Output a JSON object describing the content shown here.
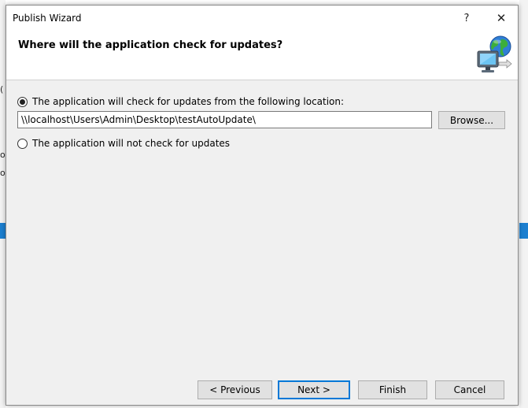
{
  "window": {
    "title": "Publish Wizard",
    "help_glyph": "?",
    "close_glyph": "✕"
  },
  "header": {
    "title": "Where will the application check for updates?",
    "icon": "globe-computer-icon"
  },
  "options": {
    "check_label": "The application will check for updates from the following location:",
    "check_selected": true,
    "no_check_label": "The application will not check for updates",
    "no_check_selected": false
  },
  "location": {
    "value": "\\\\localhost\\Users\\Admin\\Desktop\\testAutoUpdate\\",
    "browse_label": "Browse..."
  },
  "footer": {
    "previous_label": "< Previous",
    "next_label": "Next >",
    "finish_label": "Finish",
    "cancel_label": "Cancel"
  },
  "background": {
    "fragment_1": "(",
    "fragment_2": "ol",
    "fragment_3": "ol"
  },
  "colors": {
    "accent": "#0078d7",
    "dialog_bg": "#f0f0f0",
    "header_bg": "#ffffff",
    "bg_blue": "#1c7fd0"
  }
}
